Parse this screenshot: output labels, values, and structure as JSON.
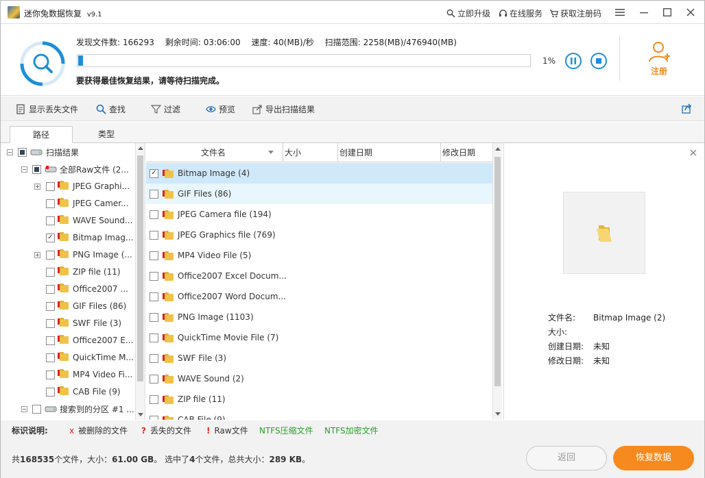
{
  "app": {
    "title": "迷你兔数据恢复",
    "version": "v9.1"
  },
  "titlebar": {
    "upgrade": "立即升级",
    "online_service": "在线服务",
    "get_code": "获取注册码"
  },
  "scan": {
    "found_label": "发现文件数:",
    "found_value": "166293",
    "remaining_label": "剩余时间:",
    "remaining_value": "03:06:00",
    "speed_label": "速度:",
    "speed_value": "40(MB)/秒",
    "range_label": "扫描范围:",
    "range_value": "2258(MB)/476940(MB)",
    "progress_percent": "1%",
    "progress_fraction": 0.01,
    "hint": "要获得最佳恢复结果，请等待扫描完成。"
  },
  "register": {
    "label": "注册"
  },
  "toolbar": {
    "show_lost": "显示丢失文件",
    "find": "查找",
    "filter": "过滤",
    "preview": "预览",
    "export": "导出扫描结果"
  },
  "tabs": [
    {
      "label": "路径",
      "active": true
    },
    {
      "label": "类型",
      "active": false
    }
  ],
  "tree": {
    "root": "扫描结果",
    "raw": "全部Raw文件 (2...",
    "items": [
      {
        "label": "JPEG Graphi...",
        "checked": false,
        "expandable": true
      },
      {
        "label": "JPEG Camer...",
        "checked": false,
        "expandable": false
      },
      {
        "label": "WAVE Sound...",
        "checked": false,
        "expandable": false
      },
      {
        "label": "Bitmap Imag...",
        "checked": true,
        "expandable": false
      },
      {
        "label": "PNG Image (...",
        "checked": false,
        "expandable": true
      },
      {
        "label": "ZIP file (11)",
        "checked": false,
        "expandable": false
      },
      {
        "label": "Office2007 ...",
        "checked": false,
        "expandable": false
      },
      {
        "label": "GIF Files (86)",
        "checked": false,
        "expandable": false
      },
      {
        "label": "SWF File (3)",
        "checked": false,
        "expandable": false
      },
      {
        "label": "Office2007 E...",
        "checked": false,
        "expandable": false
      },
      {
        "label": "QuickTime M...",
        "checked": false,
        "expandable": false
      },
      {
        "label": "MP4 Video Fi...",
        "checked": false,
        "expandable": false
      },
      {
        "label": "CAB File (9)",
        "checked": false,
        "expandable": false
      }
    ],
    "partition": "搜索到的分区 #1 ..."
  },
  "file_list": {
    "columns": [
      "文件名",
      "大小",
      "创建日期",
      "修改日期"
    ],
    "rows": [
      {
        "name": "Bitmap Image (4)",
        "checked": true,
        "state": "selected"
      },
      {
        "name": "GIF Files (86)",
        "checked": false,
        "state": "hover"
      },
      {
        "name": "JPEG Camera file (194)",
        "checked": false,
        "state": ""
      },
      {
        "name": "JPEG Graphics file (769)",
        "checked": false,
        "state": ""
      },
      {
        "name": "MP4 Video File (5)",
        "checked": false,
        "state": ""
      },
      {
        "name": "Office2007 Excel Docum...",
        "checked": false,
        "state": ""
      },
      {
        "name": "Office2007 Word Docum...",
        "checked": false,
        "state": ""
      },
      {
        "name": "PNG Image (1103)",
        "checked": false,
        "state": ""
      },
      {
        "name": "QuickTime Movie File (7)",
        "checked": false,
        "state": ""
      },
      {
        "name": "SWF File (3)",
        "checked": false,
        "state": ""
      },
      {
        "name": "WAVE Sound (2)",
        "checked": false,
        "state": ""
      },
      {
        "name": "ZIP file (11)",
        "checked": false,
        "state": ""
      },
      {
        "name": "CAB File (9)",
        "checked": false,
        "state": ""
      }
    ]
  },
  "preview": {
    "filename_label": "文件名:",
    "filename_value": "Bitmap Image (2)",
    "size_label": "大小:",
    "size_value": "",
    "created_label": "创建日期:",
    "created_value": "未知",
    "modified_label": "修改日期:",
    "modified_value": "未知"
  },
  "legend": {
    "title": "标识说明:",
    "deleted_mark": "x",
    "deleted": "被删除的文件",
    "lost_mark": "?",
    "lost": "丢失的文件",
    "raw_mark": "!",
    "raw": "Raw文件",
    "ntfs_comp": "NTFS压缩文件",
    "ntfs_enc": "NTFS加密文件"
  },
  "status": {
    "prefix": "共",
    "count": "168535",
    "files_suffix": "个文件，大小：",
    "size": "61.00 GB",
    "sel_prefix": "。 选中了",
    "sel_count": "4",
    "sel_mid": "个文件，总共大小：",
    "sel_size": "289 KB",
    "end": "。"
  },
  "buttons": {
    "back": "返回",
    "recover": "恢复数据"
  },
  "colors": {
    "accent": "#1e8fd6",
    "orange": "#f78a1e",
    "red": "#e02020",
    "green": "#2aa02a",
    "selected_row": "#cfe8fa",
    "hover_row": "#e8f6fd"
  }
}
